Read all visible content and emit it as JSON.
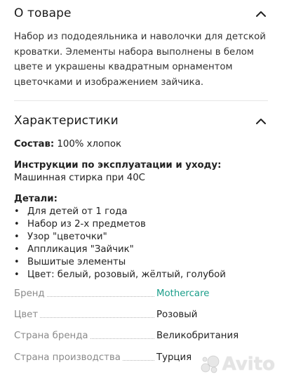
{
  "about": {
    "title": "О товаре",
    "description": "Набор из пододеяльника и наволочки для детской кроватки. Элементы набора выполнены в белом цвете и украшены квадратным орнаментом цветочками и изображением зайчика."
  },
  "specs": {
    "title": "Характеристики",
    "composition_label": "Состав:",
    "composition_value": "100% хлопок",
    "care_label": "Инструкции по эксплуатации и уходу:",
    "care_value": "Машинная стирка при 40С",
    "details_label": "Детали:",
    "details": [
      "Для детей от 1 года",
      "Набор из 2-х предметов",
      "Узор \"цветочки\"",
      "Аппликация \"Зайчик\"",
      "Вышитые элементы",
      "Цвет: белый, розовый, жёлтый, голубой"
    ],
    "properties": [
      {
        "label": "Бренд",
        "value": "Mothercare"
      },
      {
        "label": "Цвет",
        "value": "Розовый"
      },
      {
        "label": "Страна бренда",
        "value": "Великобритания"
      },
      {
        "label": "Страна производства",
        "value": "Турция"
      }
    ]
  },
  "watermark": {
    "text": "Avito"
  },
  "colors": {
    "link": "#1a9e8a",
    "muted": "#8a8a8a",
    "divider": "#e6e6e6"
  }
}
